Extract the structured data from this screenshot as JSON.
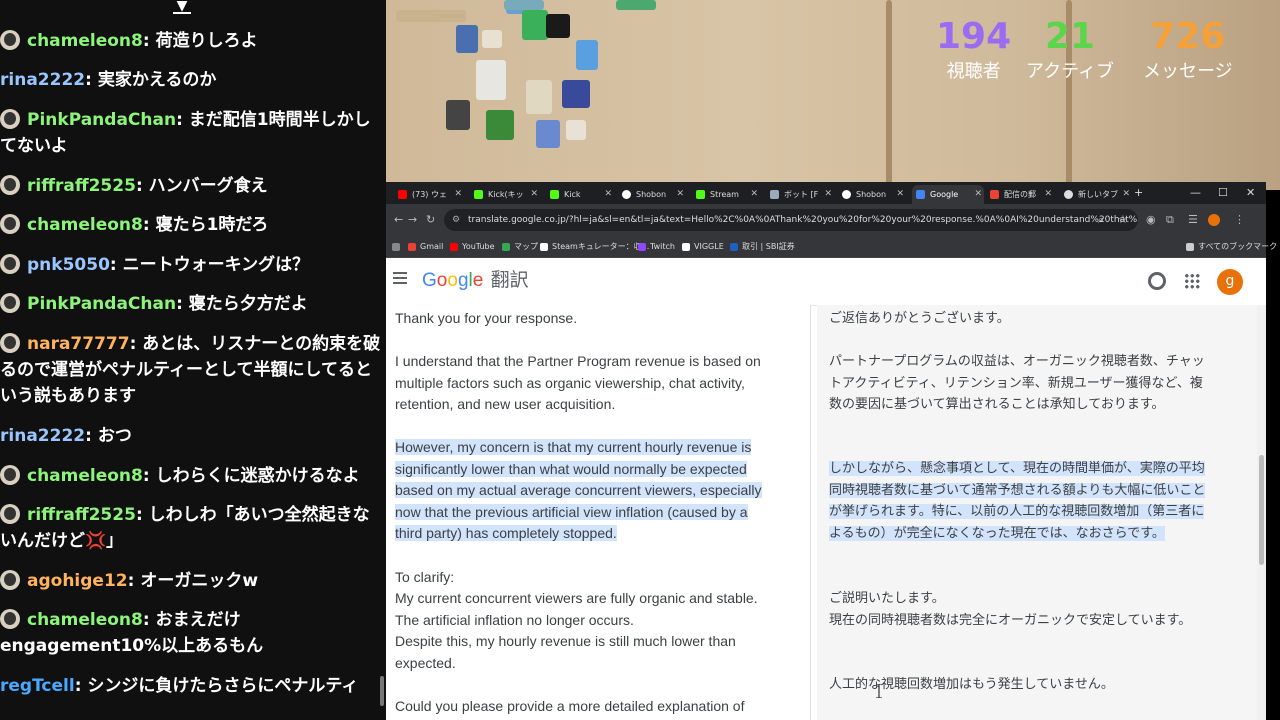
{
  "chat": {
    "messages": [
      {
        "user": "chameleon8",
        "text": "荷造りしろよ",
        "color": "green"
      },
      {
        "user": "rina2222",
        "text": "実家かえるのか",
        "color": "blue"
      },
      {
        "user": "PinkPandaChan",
        "text": "まだ配信1時間半しかしてないよ",
        "color": "green"
      },
      {
        "user": "riffraff2525",
        "text": "ハンバーグ食え",
        "color": "green"
      },
      {
        "user": "chameleon8",
        "text": "寝たら1時だろ",
        "color": "green"
      },
      {
        "user": "pnk5050",
        "text": "ニートウォーキングは？",
        "color": "blue"
      },
      {
        "user": "PinkPandaChan",
        "text": "寝たら夕方だよ",
        "color": "green"
      },
      {
        "user": "nara77777",
        "text": "あとは、リスナーとの約束を破るので運営がペナルティーとして半額にしてるという説もあります",
        "color": "orange"
      },
      {
        "user": "rina2222",
        "text": "おつ",
        "color": "blue"
      },
      {
        "user": "chameleon8",
        "text": "しわらくに迷惑かけるなよ",
        "color": "green"
      },
      {
        "user": "riffraff2525",
        "text": "しわしわ「あいつ全然起きないんだけど💢」",
        "color": "green"
      },
      {
        "user": "agohige12",
        "text": "オーガニックw",
        "color": "orange"
      },
      {
        "user": "chameleon8",
        "text": "おまえだけengagement10%以上あるもん",
        "color": "green"
      },
      {
        "user": "regTcell",
        "text": "シンジに負けたらさらにペナルティ",
        "color": "blue2"
      }
    ]
  },
  "stats": {
    "viewers": {
      "value": "194",
      "label": "視聴者",
      "color": "#9b6cf2"
    },
    "active": {
      "value": "21",
      "label": "アクティブ",
      "color": "#5bd64a"
    },
    "messages": {
      "value": "726",
      "label": "メッセージ",
      "color": "#f5a13a"
    }
  },
  "browser": {
    "tabs": [
      {
        "label": "(73) ウェ",
        "icon_color": "#ff0000"
      },
      {
        "label": "Kick(キッ",
        "icon_color": "#53fc18"
      },
      {
        "label": "Kick",
        "icon_color": "#53fc18"
      },
      {
        "label": "Shobon",
        "icon_color": "#ffffff"
      },
      {
        "label": "Stream",
        "icon_color": "#53fc18"
      },
      {
        "label": "ボット [F",
        "icon_color": "#9ab"
      },
      {
        "label": "Shobon",
        "icon_color": "#ffffff"
      },
      {
        "label": "Google",
        "icon_color": "#4285f4"
      },
      {
        "label": "配信の郵",
        "icon_color": "#ea4335"
      },
      {
        "label": "新しいタブ",
        "icon_color": "#ddd"
      }
    ],
    "url": "translate.google.co.jp/?hl=ja&sl=en&tl=ja&text=Hello%2C%0A%0AThank%20you%20for%20your%20response.%0A%0AI%20understand%20that%20the%20Par...",
    "bookmarks": [
      {
        "label": "Gmail",
        "icon_color": "#ea4335"
      },
      {
        "label": "YouTube",
        "icon_color": "#ff0000"
      },
      {
        "label": "マップ",
        "icon_color": "#34a853"
      },
      {
        "label": "Steamキュレーター：収...",
        "icon_color": "#ffffff"
      },
      {
        "label": "Twitch",
        "icon_color": "#9146ff"
      },
      {
        "label": "VIGGLE",
        "icon_color": "#ffffff"
      },
      {
        "label": "取引 | SBI証券",
        "icon_color": "#1f5fbf"
      }
    ],
    "all_bookmarks": "すべてのブックマーク"
  },
  "translate": {
    "logo_letters": [
      "G",
      "o",
      "o",
      "g",
      "l",
      "e"
    ],
    "service_name": "翻訳",
    "avatar_letter": "g",
    "source": [
      "Thank you for your response.",
      "I understand that the Partner Program revenue is based on multiple factors such as organic viewership, chat activity, retention, and new user acquisition.",
      "However, my concern is that my current hourly revenue is significantly lower than what would normally be expected based on my actual average concurrent viewers, especially now that the previous artificial view inflation (caused by a third party) has completely stopped.",
      "To clarify:",
      "My current concurrent viewers are fully organic and stable.",
      "The artificial inflation no longer occurs.",
      "Despite this, my hourly revenue is still much lower than expected.",
      "Could you please provide a more detailed explanation of"
    ],
    "target": [
      "ご返信ありがとうございます。",
      "パートナープログラムの収益は、オーガニック視聴者数、チャットアクティビティ、リテンション率、新規ユーザー獲得など、複数の要因に基づいて算出されることは承知しております。",
      "しかしながら、懸念事項として、現在の時間単価が、実際の平均同時視聴者数に基づいて通常予想される額よりも大幅に低いことが挙げられます。特に、以前の人工的な視聴回数増加（第三者によるもの）が完全になくなった現在では、なおさらです。",
      "ご説明いたします。",
      "現在の同時視聴者数は完全にオーガニックで安定しています。",
      "人工的な視聴回数増加はもう発生していません。"
    ]
  }
}
